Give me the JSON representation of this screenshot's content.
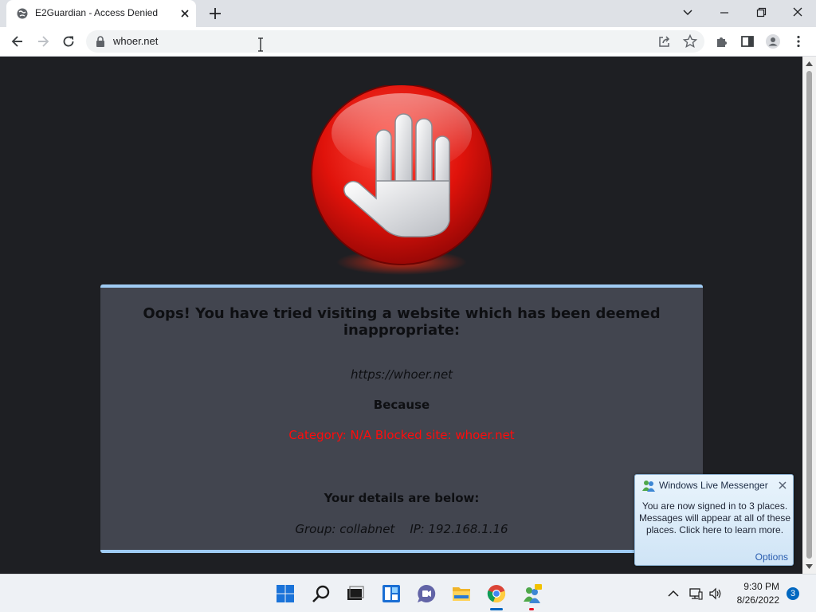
{
  "browser": {
    "tab_title": "E2Guardian - Access Denied",
    "url": "whoer.net"
  },
  "page": {
    "headline": "Oops! You have tried visiting a website which has been deemed inappropriate:",
    "blocked_url": "https://whoer.net",
    "because_label": "Because",
    "reason": "Category: N/A   Blocked site: whoer.net",
    "details_heading": "Your details are below:",
    "details": "Group: collabnet    IP: 192.168.1.16"
  },
  "messenger_popup": {
    "title": "Windows Live Messenger",
    "body": "You are now signed in to 3 places. Messages will appear at all of these places. Click here to learn more.",
    "options_link": "Options"
  },
  "taskbar": {
    "apps": [
      "start-icon",
      "search-icon",
      "task-view-icon",
      "widgets-icon",
      "teams-chat-icon",
      "file-explorer-icon",
      "chrome-icon",
      "messenger-icon"
    ],
    "clock_time": "9:30 PM",
    "clock_date": "8/26/2022",
    "notification_count": "3"
  },
  "colors": {
    "page_background": "#1e1f23",
    "panel_background": "#42454f",
    "panel_border": "#9fcbf3",
    "reason_text": "#ff0b0b"
  }
}
